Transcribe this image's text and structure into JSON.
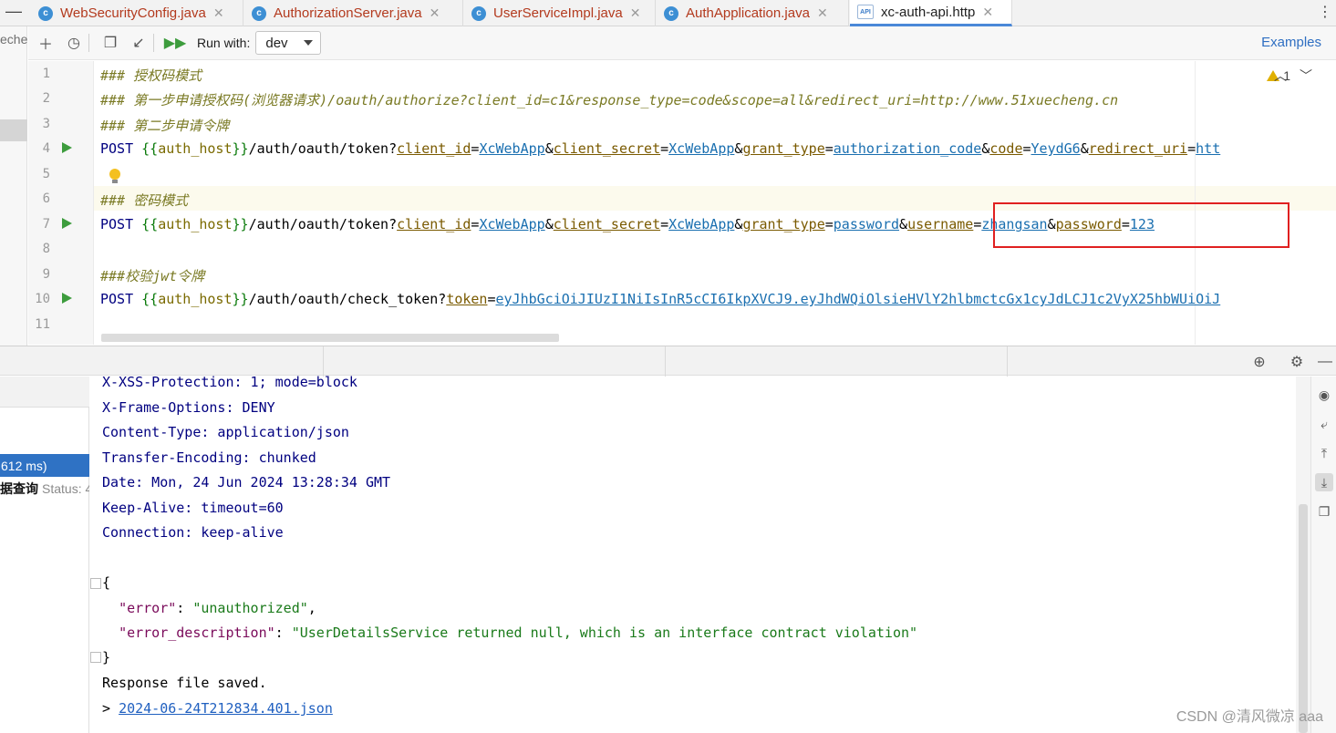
{
  "tabs": [
    {
      "label": "WebSecurityConfig.java",
      "icon": "class-icon"
    },
    {
      "label": "AuthorizationServer.java",
      "icon": "class-icon"
    },
    {
      "label": "UserServiceImpl.java",
      "icon": "class-icon"
    },
    {
      "label": "AuthApplication.java",
      "icon": "class-icon"
    },
    {
      "label": "xc-auth-api.http",
      "icon": "api-file-icon"
    }
  ],
  "left_strip_text": "eche",
  "toolbar": {
    "run_with_label": "Run with:",
    "env_value": "dev",
    "examples_label": "Examples"
  },
  "editor": {
    "line_numbers": [
      "1",
      "2",
      "3",
      "4",
      "5",
      "6",
      "7",
      "8",
      "9",
      "10",
      "11"
    ],
    "warnings_count": "1",
    "line1": "### 授权码模式",
    "line2": "### 第一步申请授权码(浏览器请求)/oauth/authorize?client_id=c1&response_type=code&scope=all&redirect_uri=http://www.51xuecheng.cn",
    "line3": "### 第二步申请令牌",
    "line4": {
      "method": "POST",
      "open": "{{",
      "var": "auth_host",
      "close": "}}",
      "path": "/auth/oauth/token?",
      "params": [
        [
          "client_id",
          "XcWebApp"
        ],
        [
          "client_secret",
          "XcWebApp"
        ],
        [
          "grant_type",
          "authorization_code"
        ],
        [
          "code",
          "YeydG6"
        ],
        [
          "redirect_uri",
          "htt"
        ]
      ]
    },
    "line6": "### 密码模式",
    "line7": {
      "method": "POST",
      "open": "{{",
      "var": "auth_host",
      "close": "}}",
      "path": "/auth/oauth/token?",
      "params": [
        [
          "client_id",
          "XcWebApp"
        ],
        [
          "client_secret",
          "XcWebApp"
        ],
        [
          "grant_type",
          "password"
        ],
        [
          "username",
          "zhangsan"
        ],
        [
          "password",
          "123"
        ]
      ]
    },
    "line9": "###校验jwt令牌",
    "line10": {
      "method": "POST",
      "open": "{{",
      "var": "auth_host",
      "close": "}}",
      "path": "/auth/oauth/check_token?",
      "params": [
        [
          "token",
          "eyJhbGciOiJIUzI1NiIsInR5cCI6IkpXVCJ9.eyJhdWQiOlsieHVlY2hlbmctcGx1cyJdLCJ1c2VyX25hbWUiOiJ"
        ]
      ]
    }
  },
  "request_list": {
    "selected_label": "612 ms)",
    "item_bold": "据查询",
    "item_status": "Status: 4"
  },
  "response": {
    "headers": [
      "X-XSS-Protection: 1; mode=block",
      "X-Frame-Options: DENY",
      "Content-Type: application/json",
      "Transfer-Encoding: chunked",
      "Date: Mon, 24 Jun 2024 13:28:34 GMT",
      "Keep-Alive: timeout=60",
      "Connection: keep-alive"
    ],
    "json_open": "{",
    "json_close": "}",
    "error_key": "\"error\"",
    "error_value": "\"unauthorized\"",
    "desc_key": "\"error_description\"",
    "desc_value": "\"UserDetailsService returned null, which is an interface contract violation\"",
    "saved_text": "Response file saved.",
    "file_prefix": "> ",
    "file_link": "2024-06-24T212834.401.json"
  },
  "watermark": "CSDN @清风微凉 aaa"
}
